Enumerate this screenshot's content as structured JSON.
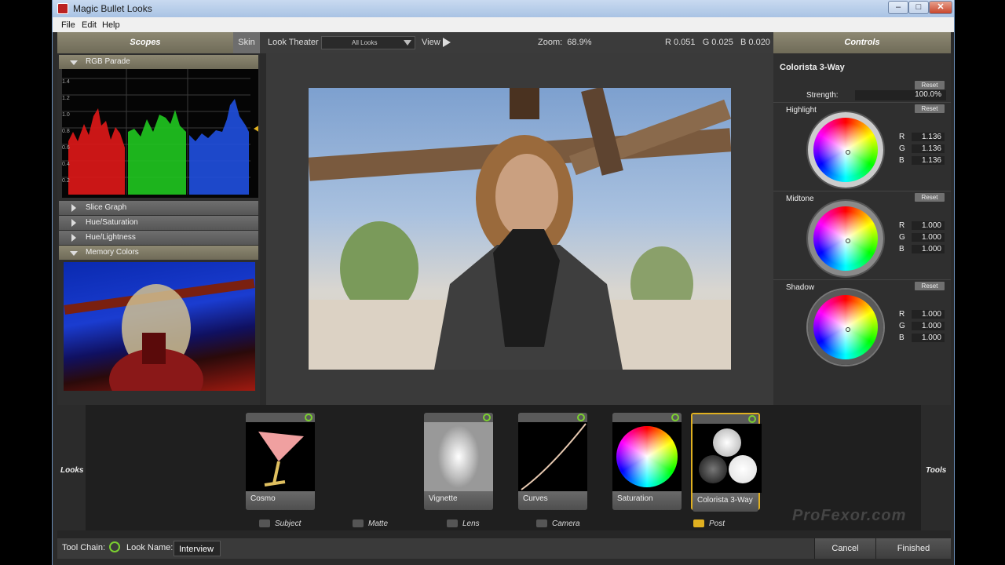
{
  "window": {
    "title": "Magic Bullet Looks",
    "close": "✕",
    "max": "□",
    "min": "–"
  },
  "menu": [
    "File",
    "Edit",
    "Help"
  ],
  "header": {
    "scopes": "Scopes",
    "skin": "Skin",
    "look_theater": "Look Theater",
    "looks_filter": "All Looks",
    "view": "View",
    "zoom": "Zoom:  68.9%",
    "rgb_readout": "R 0.051   G 0.025   B 0.020",
    "controls": "Controls"
  },
  "scopes": {
    "rgb_parade": "RGB Parade",
    "y_ticks": [
      "1.4",
      "1.2",
      "1.0",
      "0.8",
      "0.6",
      "0.4",
      "0.2",
      "0"
    ],
    "slice_graph": "Slice Graph",
    "hue_saturation": "Hue/Saturation",
    "hue_lightness": "Hue/Lightness",
    "memory_colors": "Memory Colors"
  },
  "controls": {
    "tool_name": "Colorista 3-Way",
    "reset": "Reset",
    "strength_label": "Strength:",
    "strength_value": "100.0%",
    "highlight": {
      "label": "Highlight",
      "r": "1.136",
      "g": "1.136",
      "b": "1.136"
    },
    "midtone": {
      "label": "Midtone",
      "r": "1.000",
      "g": "1.000",
      "b": "1.000"
    },
    "shadow": {
      "label": "Shadow",
      "r": "1.000",
      "g": "1.000",
      "b": "1.000"
    },
    "r": "R",
    "g": "G",
    "b": "B"
  },
  "chain": {
    "looks_label": "Looks",
    "tools_label": "Tools",
    "tiles": [
      "Cosmo",
      "Vignette",
      "Curves",
      "Saturation",
      "Colorista 3-Way"
    ],
    "categories": [
      "Subject",
      "Matte",
      "Lens",
      "Camera",
      "Post"
    ],
    "watermark": "ProFexor.com"
  },
  "footer": {
    "tool_chain": "Tool Chain:",
    "look_name_label": "Look Name:",
    "look_name": "Interview",
    "cancel": "Cancel",
    "finished": "Finished"
  }
}
